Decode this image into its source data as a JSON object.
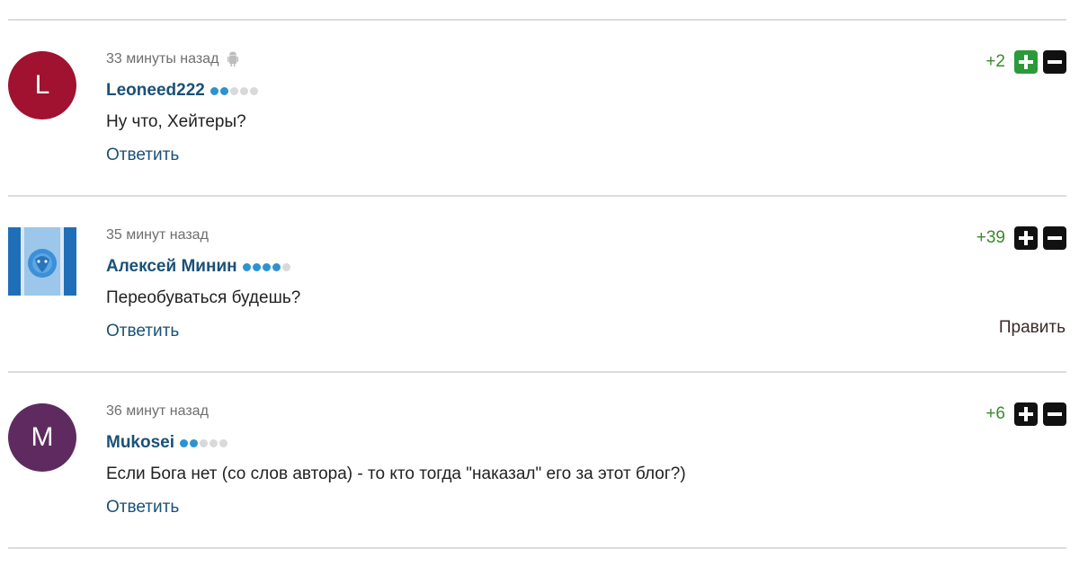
{
  "comments": [
    {
      "avatar_letter": "L",
      "avatar_color": "#a01230",
      "time": "33 минуты назад",
      "has_android_icon": true,
      "author": "Leoneed222",
      "rank_dots": 2,
      "text": "Ну что, Хейтеры?",
      "reply_label": "Ответить",
      "score": "+2",
      "plus_active": true
    },
    {
      "avatar_letter": "",
      "avatar_color": "#2a6fb3",
      "time": "35 минут назад",
      "author": "Алексей Минин",
      "rank_dots": 4,
      "text": "Переобуваться будешь?",
      "reply_label": "Ответить",
      "edit_label": "Править",
      "score": "+39",
      "plus_active": false
    },
    {
      "avatar_letter": "M",
      "avatar_color": "#5e2a5f",
      "time": "36 минут назад",
      "author": "Mukosei",
      "rank_dots": 2,
      "text": "Если Бога нет (со слов автора) - то кто тогда \"наказал\" его за этот блог?)",
      "reply_label": "Ответить",
      "score": "+6",
      "plus_active": false
    }
  ],
  "colors": {
    "score_green": "#3a8a2f",
    "author_blue": "#1a5177",
    "dot_active": "#2c93d1",
    "dot_inactive": "#d9d9d9",
    "plus_active_green": "#2b9a3b"
  }
}
